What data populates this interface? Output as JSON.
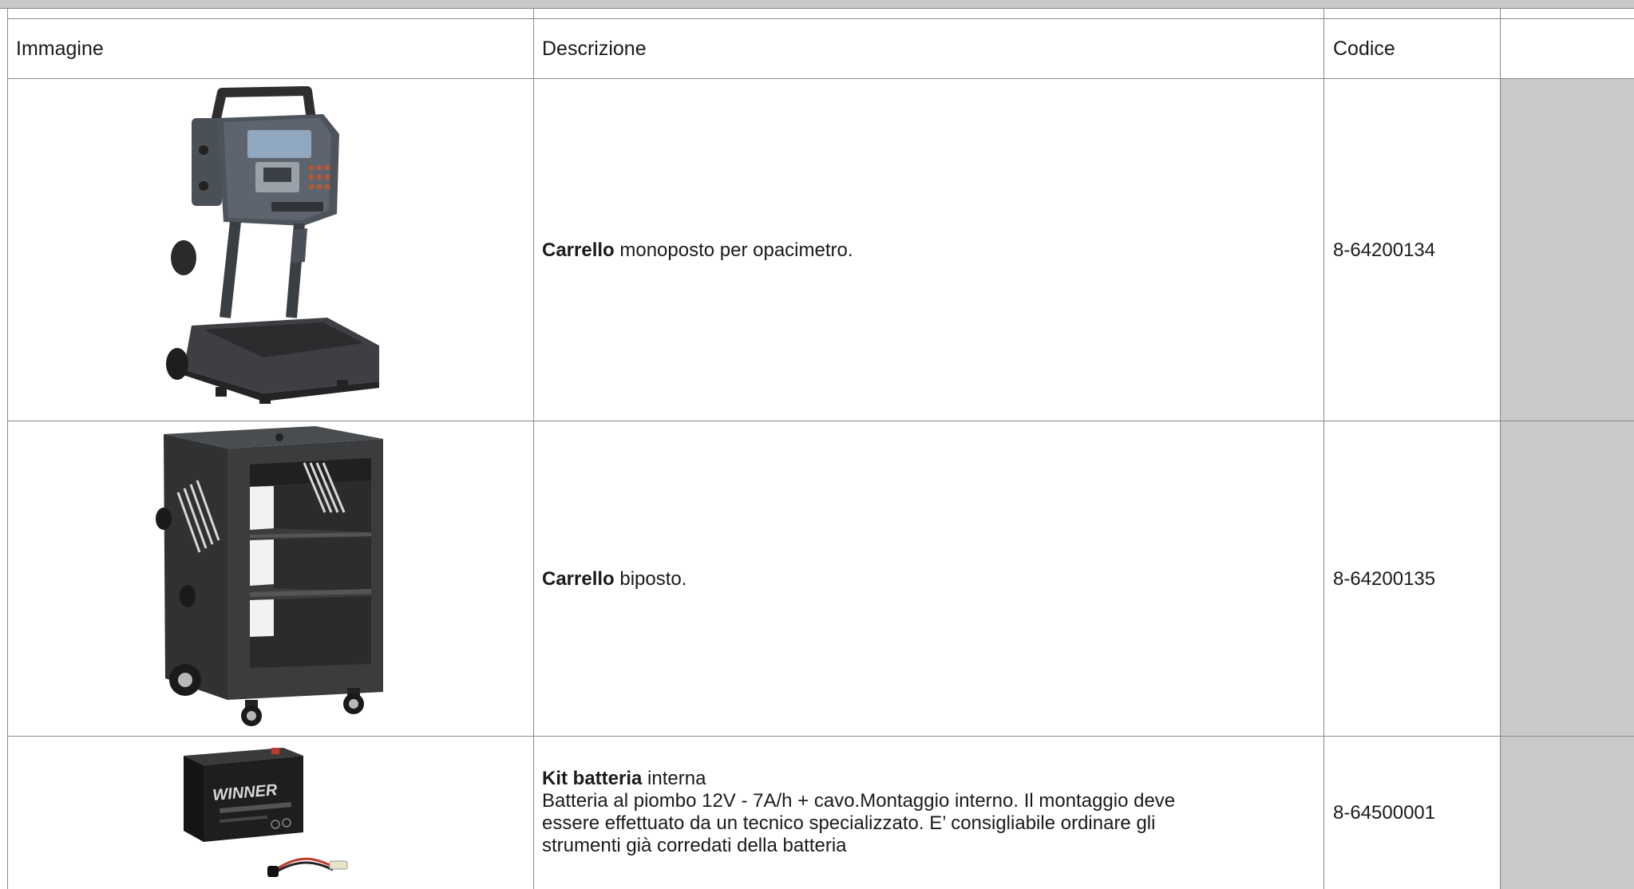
{
  "table": {
    "headers": [
      "Immagine",
      "Descrizione",
      "Codice",
      ""
    ],
    "rows": [
      {
        "image_icon": "opacimeter-cart-image",
        "desc_bold": "Carrello",
        "desc_rest": " monoposto per opacimetro.",
        "code": "8-64200134"
      },
      {
        "image_icon": "two-place-cart-image",
        "desc_bold": "Carrello",
        "desc_rest": " biposto.",
        "code": "8-64200135"
      },
      {
        "image_icon": "battery-kit-image",
        "desc_bold": "Kit batteria",
        "desc_rest": " interna",
        "desc_line2": "Batteria al piombo 12V - 7A/h + cavo.Montaggio interno. Il montaggio deve",
        "desc_line3": "essere effettuato da un tecnico specializzato. E’ consigliabile ordinare gli",
        "desc_line4": "strumenti già corredati della batteria",
        "code": "8-64500001",
        "battery_brand": "WINNER"
      }
    ]
  },
  "colors": {
    "gray_column": "#c9c9c9",
    "grid_line": "#8a8a8a"
  }
}
